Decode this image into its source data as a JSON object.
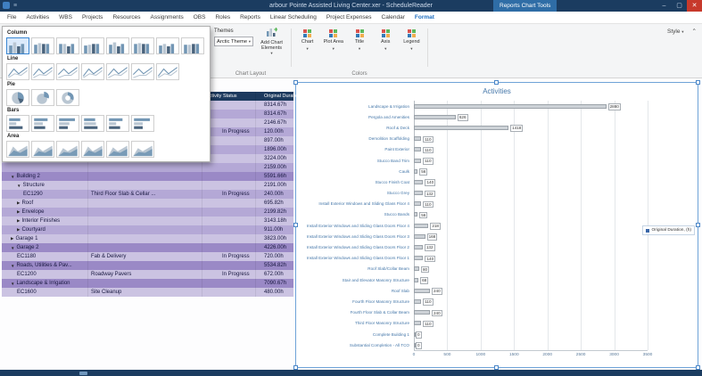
{
  "title_bar": {
    "title": "arbour Pointe Assisted Living Center.xer - ScheduleReader",
    "context_tab": "Reports Chart Tools",
    "minimize": "–",
    "maximize": "▢",
    "close": "✕",
    "menu_glyph": "≡"
  },
  "menu": {
    "tabs": [
      "File",
      "Activities",
      "WBS",
      "Projects",
      "Resources",
      "Assignments",
      "OBS",
      "Roles",
      "Reports",
      "Linear Scheduling",
      "Project Expenses",
      "Calendar",
      "Format"
    ],
    "active": "Format"
  },
  "ribbon": {
    "themes_label": "Themes",
    "theme_selected": "Arctic Theme",
    "add_elements_label": "Add Chart Elements",
    "chart_layout_caption": "Chart Layout",
    "colors_caption": "Colors",
    "color_buttons": [
      "Chart",
      "Plot Area",
      "Title",
      "Axis",
      "Legend"
    ],
    "style_label": "Style",
    "collapse_glyph": "⌃"
  },
  "gallery": {
    "sections": [
      {
        "label": "Column",
        "type": "column",
        "count": 8,
        "selected": 0
      },
      {
        "label": "Line",
        "type": "line",
        "count": 7,
        "selected": -1
      },
      {
        "label": "Pie",
        "type": "pie",
        "count": 3,
        "selected": -1
      },
      {
        "label": "Bars",
        "type": "bars",
        "count": 6,
        "selected": -1
      },
      {
        "label": "Area",
        "type": "area",
        "count": 6,
        "selected": -1
      }
    ]
  },
  "table": {
    "status_header": "Activity Status",
    "duration_header": "Original Duration",
    "rows": [
      {
        "name": "",
        "desc": "",
        "status": "",
        "dur": "8314.67h",
        "level": 0,
        "arrow": "",
        "shade": "light"
      },
      {
        "name": "",
        "desc": "",
        "status": "",
        "dur": "8314.67h",
        "level": 0,
        "arrow": "",
        "shade": "medium"
      },
      {
        "name": "",
        "desc": "",
        "status": "",
        "dur": "2146.67h",
        "level": 0,
        "arrow": "",
        "shade": "light"
      },
      {
        "name": "",
        "desc": "",
        "status": "In Progress",
        "dur": "120.00h",
        "level": 0,
        "arrow": "",
        "shade": "medium"
      },
      {
        "name": "",
        "desc": "",
        "status": "",
        "dur": "897.00h",
        "level": 0,
        "arrow": "",
        "shade": "light"
      },
      {
        "name": "",
        "desc": "",
        "status": "",
        "dur": "1896.00h",
        "level": 0,
        "arrow": "",
        "shade": "medium"
      },
      {
        "name": "",
        "desc": "",
        "status": "",
        "dur": "3224.00h",
        "level": 0,
        "arrow": "",
        "shade": "light"
      },
      {
        "name": "",
        "desc": "",
        "status": "",
        "dur": "2159.00h",
        "level": 0,
        "arrow": "",
        "shade": "medium"
      },
      {
        "name": "Building 2",
        "desc": "",
        "status": "",
        "dur": "5591.66h",
        "level": 1,
        "arrow": "▼",
        "shade": "group"
      },
      {
        "name": "Structure",
        "desc": "",
        "status": "",
        "dur": "2191.00h",
        "level": 2,
        "arrow": "▼",
        "shade": "light"
      },
      {
        "name": "EC1290",
        "desc": "Third Floor Slab & Cellar ...",
        "status": "In Progress",
        "dur": "240.00h",
        "level": 3,
        "arrow": "",
        "shade": "medium"
      },
      {
        "name": "Roof",
        "desc": "",
        "status": "",
        "dur": "695.82h",
        "level": 2,
        "arrow": "▶",
        "shade": "light"
      },
      {
        "name": "Envelope",
        "desc": "",
        "status": "",
        "dur": "2199.82h",
        "level": 2,
        "arrow": "▶",
        "shade": "medium"
      },
      {
        "name": "Interior Finishes",
        "desc": "",
        "status": "",
        "dur": "3143.18h",
        "level": 2,
        "arrow": "▶",
        "shade": "light"
      },
      {
        "name": "Courtyard",
        "desc": "",
        "status": "",
        "dur": "911.00h",
        "level": 2,
        "arrow": "▶",
        "shade": "medium"
      },
      {
        "name": "Garage 1",
        "desc": "",
        "status": "",
        "dur": "3823.00h",
        "level": 1,
        "arrow": "▶",
        "shade": "light"
      },
      {
        "name": "Garage 2",
        "desc": "",
        "status": "",
        "dur": "4226.00h",
        "level": 1,
        "arrow": "▼",
        "shade": "group"
      },
      {
        "name": "EC1180",
        "desc": "Fab & Delivery",
        "status": "In Progress",
        "dur": "720.00h",
        "level": 2,
        "arrow": "",
        "shade": "light"
      },
      {
        "name": "Roads, Utilities & Pav...",
        "desc": "",
        "status": "",
        "dur": "5534.82h",
        "level": 1,
        "arrow": "▼",
        "shade": "group"
      },
      {
        "name": "EC1200",
        "desc": "Roadway Pavers",
        "status": "In Progress",
        "dur": "672.00h",
        "level": 2,
        "arrow": "",
        "shade": "light"
      },
      {
        "name": "Landscape & Irrigation",
        "desc": "",
        "status": "",
        "dur": "7090.67h",
        "level": 1,
        "arrow": "▼",
        "shade": "group"
      },
      {
        "name": "EC1600",
        "desc": "Site Cleanup",
        "status": "",
        "dur": "480.00h",
        "level": 2,
        "arrow": "",
        "shade": "light"
      }
    ]
  },
  "chart_data": {
    "type": "bar",
    "orientation": "horizontal",
    "title": "Activities",
    "legend": [
      "Original Duration, (h)"
    ],
    "legend_position": "right",
    "xlim": [
      0,
      3500
    ],
    "x_ticks": [
      0,
      500,
      1000,
      1500,
      2000,
      2500,
      3000,
      3500
    ],
    "grid": true,
    "categories": [
      "Landscape & Irrigation",
      "Pergola and Amenities",
      "Roof & Deck",
      "Demolition Scaffolding",
      "Paint Exterior",
      "Stucco Band Trim",
      "Caulk",
      "Stucco Finish Coat",
      "Stucco Grey",
      "Install Exterior Windows and Sliding Glass Floor 4",
      "Stucco Bands",
      "Install Exterior Windows and Sliding Glass Doors Floor 4",
      "Install Exterior Windows and Sliding Glass Doors Floor 3",
      "Install Exterior Windows and Sliding Glass Doors Floor 2",
      "Install Exterior Windows and Sliding Glass Doors Floor 1",
      "Roof Slab/Collar Beam",
      "Stair and Elevator Masonry Structure",
      "Roof Slab",
      "Fourth Floor Masonry Structure",
      "Fourth Floor Slab & Collar Beam",
      "Third Floor Masonry Structure",
      "Complete Building 1",
      "Substantial Completion - All TCO"
    ],
    "values": [
      2880,
      626,
      1418,
      110,
      110,
      110,
      56,
      140,
      132,
      110,
      56,
      218,
      168,
      132,
      140,
      80,
      68,
      240,
      110,
      240,
      110,
      0,
      0
    ],
    "bar_color": "#cdd2d7",
    "accent_color": "#3a66a8"
  },
  "colors": {
    "titlebar": "#1b3c60",
    "badge": "#2f6da6",
    "accent": "#1f6fc0",
    "row_light": "#cbc3e2",
    "row_medium": "#b4a8d6",
    "row_group": "#9a89c6",
    "table_header_bg": "#1d3a5e"
  }
}
